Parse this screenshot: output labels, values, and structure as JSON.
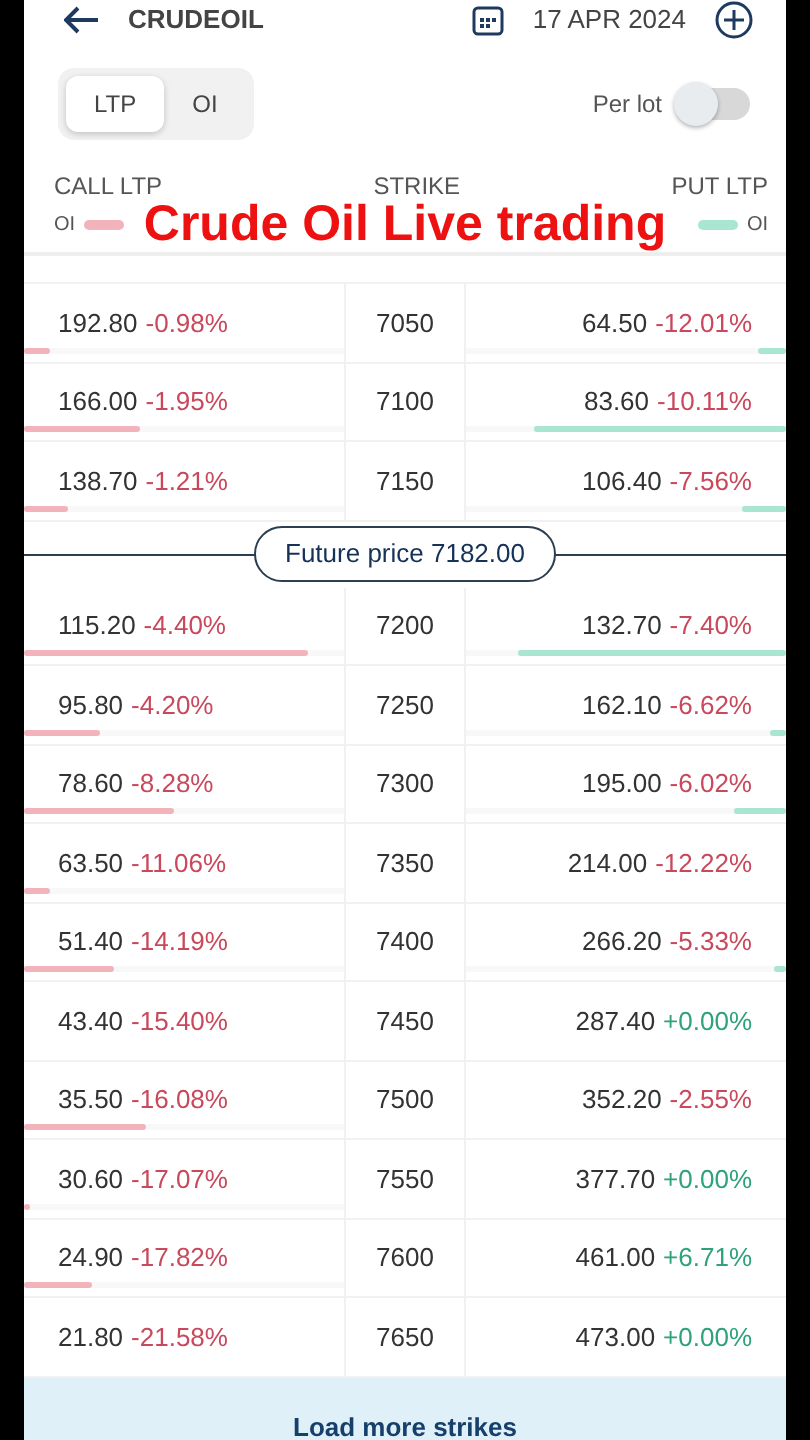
{
  "header": {
    "title": "CRUDEOIL",
    "date": "17 APR 2024"
  },
  "view_tabs": [
    {
      "label": "LTP",
      "selected": true
    },
    {
      "label": "OI",
      "selected": false
    }
  ],
  "per_lot": {
    "label": "Per lot",
    "on": false
  },
  "columns": {
    "call": "CALL LTP",
    "strike": "STRIKE",
    "put": "PUT LTP",
    "call_legend": "OI",
    "put_legend": "OI"
  },
  "caption": [
    "Crude Oil Live",
    "trading"
  ],
  "rows_above": [
    {
      "strike": "7050",
      "call_ltp": "192.80",
      "call_change": {
        "text": "-0.98%",
        "color": "#c9485b"
      },
      "call_oi": {
        "level": 0.08
      },
      "put_ltp": "64.50",
      "put_change": {
        "text": "-12.01%",
        "color": "#c9485b"
      },
      "put_oi": {
        "level": 0.09
      }
    },
    {
      "strike": "7100",
      "call_ltp": "166.00",
      "call_change": {
        "text": "-1.95%",
        "color": "#c9485b"
      },
      "call_oi": {
        "level": 0.36
      },
      "put_ltp": "83.60",
      "put_change": {
        "text": "-10.11%",
        "color": "#c9485b"
      },
      "put_oi": {
        "level": 0.79
      }
    },
    {
      "strike": "7150",
      "call_ltp": "138.70",
      "call_change": {
        "text": "-1.21%",
        "color": "#c9485b"
      },
      "call_oi": {
        "level": 0.14
      },
      "put_ltp": "106.40",
      "put_change": {
        "text": "-7.56%",
        "color": "#c9485b"
      },
      "put_oi": {
        "level": 0.14
      }
    }
  ],
  "future_price": "Future price 7182.00",
  "rows_below": [
    {
      "strike": "7200",
      "call_ltp": "115.20",
      "call_change": {
        "text": "-4.40%",
        "color": "#c9485b"
      },
      "call_oi": {
        "level": 0.89
      },
      "put_ltp": "132.70",
      "put_change": {
        "text": "-7.40%",
        "color": "#c9485b"
      },
      "put_oi": {
        "level": 0.84
      }
    },
    {
      "strike": "7250",
      "call_ltp": "95.80",
      "call_change": {
        "text": "-4.20%",
        "color": "#c9485b"
      },
      "call_oi": {
        "level": 0.24
      },
      "put_ltp": "162.10",
      "put_change": {
        "text": "-6.62%",
        "color": "#c9485b"
      },
      "put_oi": {
        "level": 0.05
      }
    },
    {
      "strike": "7300",
      "call_ltp": "78.60",
      "call_change": {
        "text": "-8.28%",
        "color": "#c9485b"
      },
      "call_oi": {
        "level": 0.47
      },
      "put_ltp": "195.00",
      "put_change": {
        "text": "-6.02%",
        "color": "#c9485b"
      },
      "put_oi": {
        "level": 0.16
      }
    },
    {
      "strike": "7350",
      "call_ltp": "63.50",
      "call_change": {
        "text": "-11.06%",
        "color": "#c9485b"
      },
      "call_oi": {
        "level": 0.08
      },
      "put_ltp": "214.00",
      "put_change": {
        "text": "-12.22%",
        "color": "#c9485b"
      }
    },
    {
      "strike": "7400",
      "call_ltp": "51.40",
      "call_change": {
        "text": "-14.19%",
        "color": "#c9485b"
      },
      "call_oi": {
        "level": 0.28
      },
      "put_ltp": "266.20",
      "put_change": {
        "text": "-5.33%",
        "color": "#c9485b"
      },
      "put_oi": {
        "level": 0.04
      }
    },
    {
      "strike": "7450",
      "call_ltp": "43.40",
      "call_change": {
        "text": "-15.40%",
        "color": "#c9485b"
      },
      "put_ltp": "287.40",
      "put_change": {
        "text": "+0.00%",
        "color": "#2ea37a"
      }
    },
    {
      "strike": "7500",
      "call_ltp": "35.50",
      "call_change": {
        "text": "-16.08%",
        "color": "#c9485b"
      },
      "call_oi": {
        "level": 0.38
      },
      "put_ltp": "352.20",
      "put_change": {
        "text": "-2.55%",
        "color": "#c9485b"
      }
    },
    {
      "strike": "7550",
      "call_ltp": "30.60",
      "call_change": {
        "text": "-17.07%",
        "color": "#c9485b"
      },
      "call_oi": {
        "level": 0.02
      },
      "put_ltp": "377.70",
      "put_change": {
        "text": "+0.00%",
        "color": "#2ea37a"
      }
    },
    {
      "strike": "7600",
      "call_ltp": "24.90",
      "call_change": {
        "text": "-17.82%",
        "color": "#c9485b"
      },
      "call_oi": {
        "level": 0.21
      },
      "put_ltp": "461.00",
      "put_change": {
        "text": "+6.71%",
        "color": "#2ea37a"
      }
    },
    {
      "strike": "7650",
      "call_ltp": "21.80",
      "call_change": {
        "text": "-21.58%",
        "color": "#c9485b"
      },
      "put_ltp": "473.00",
      "put_change": {
        "text": "+0.00%",
        "color": "#2ea37a"
      }
    }
  ],
  "load_more": "Load more strikes"
}
